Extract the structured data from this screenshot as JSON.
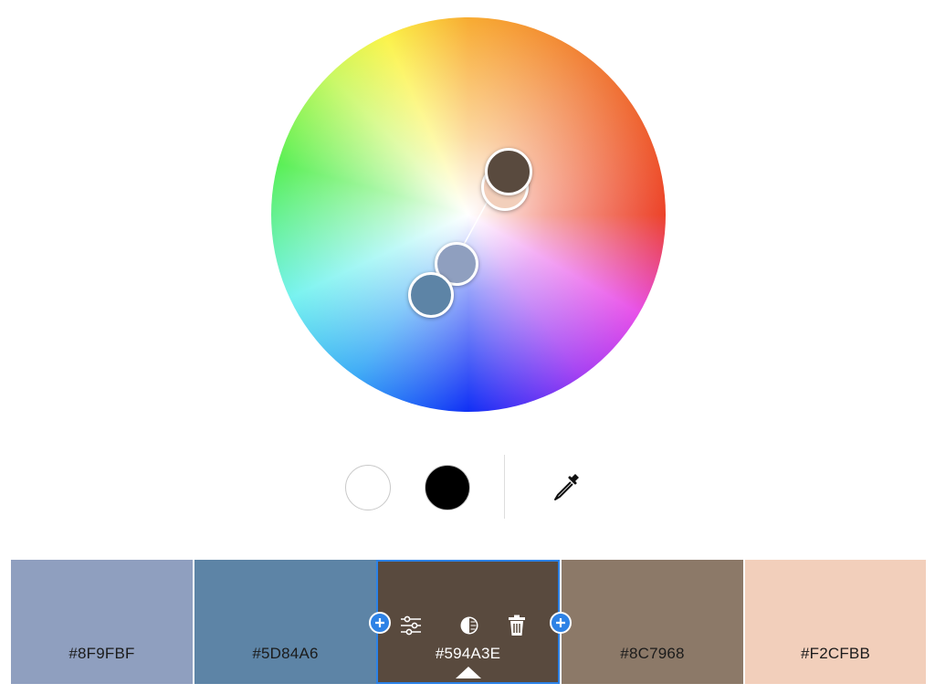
{
  "wheel": {
    "handles": [
      {
        "name": "handle-594a3e",
        "color": "#594A3E"
      },
      {
        "name": "handle-f2cfbb",
        "color": "#F2CFBB"
      },
      {
        "name": "handle-8f9fbf",
        "color": "#8F9FBF"
      },
      {
        "name": "handle-5d84a6",
        "color": "#5D84A6"
      }
    ]
  },
  "controls": {
    "white_color": "#FFFFFF",
    "black_color": "#000000",
    "eyedropper_icon": "eyedropper-icon"
  },
  "palette": {
    "selected_index": 2,
    "swatches": [
      {
        "hex": "#8F9FBF",
        "color": "#8F9FBF"
      },
      {
        "hex": "#5D84A6",
        "color": "#5D84A6"
      },
      {
        "hex": "#594A3E",
        "color": "#594A3E"
      },
      {
        "hex": "#8C7968",
        "color": "#8C7968"
      },
      {
        "hex": "#F2CFBB",
        "color": "#F2CFBB"
      }
    ],
    "tools": [
      "sliders-icon",
      "contrast-icon",
      "trash-icon"
    ],
    "add_icon": "plus-icon",
    "accent_color": "#2D82E6"
  }
}
